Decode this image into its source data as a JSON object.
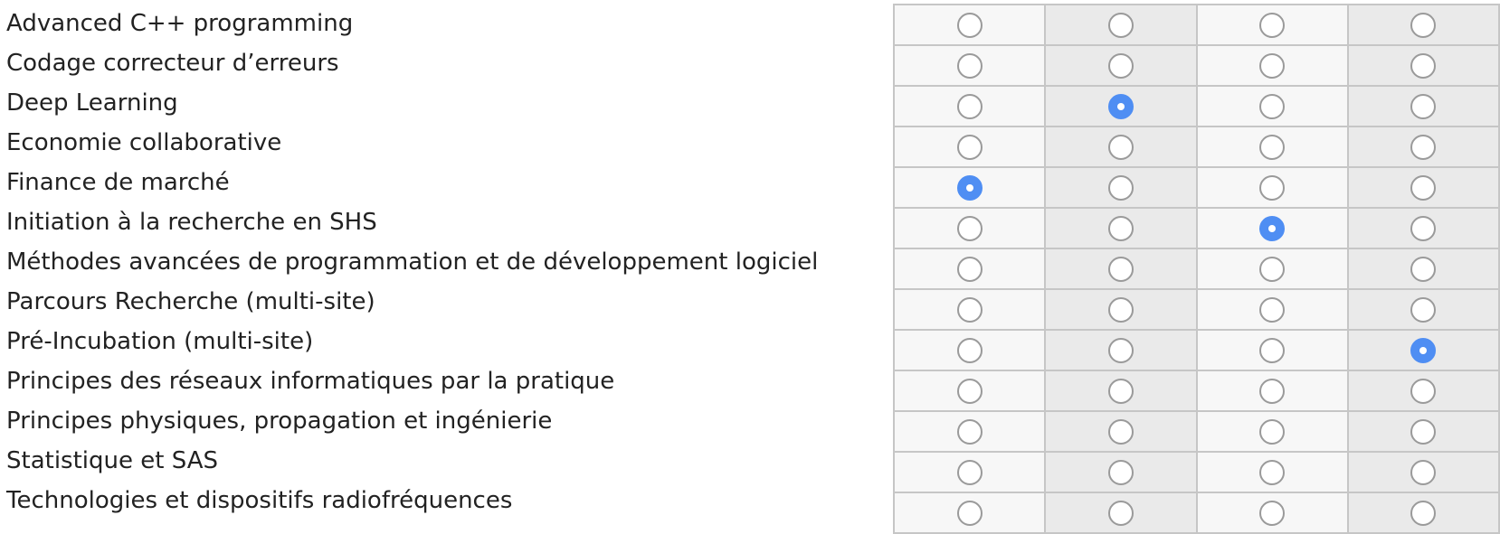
{
  "rows": [
    {
      "label": "Advanced C++ programming",
      "selected": null
    },
    {
      "label": "Codage correcteur d’erreurs",
      "selected": null
    },
    {
      "label": "Deep Learning",
      "selected": 1
    },
    {
      "label": "Economie collaborative",
      "selected": null
    },
    {
      "label": "Finance de marché",
      "selected": 0
    },
    {
      "label": "Initiation à la recherche en SHS",
      "selected": 2
    },
    {
      "label": "Méthodes avancées de programmation et de développement logiciel",
      "selected": null
    },
    {
      "label": "Parcours Recherche (multi-site)",
      "selected": null
    },
    {
      "label": "Pré-Incubation (multi-site)",
      "selected": 3
    },
    {
      "label": "Principes des réseaux informatiques par la pratique",
      "selected": null
    },
    {
      "label": "Principes physiques, propagation et ingénierie",
      "selected": null
    },
    {
      "label": "Statistique et SAS",
      "selected": null
    },
    {
      "label": "Technologies et dispositifs radiofréquences",
      "selected": null
    }
  ],
  "columns": 4,
  "colors": {
    "selected": "#4f8ef3",
    "cell_light": "#f7f7f7",
    "cell_dark": "#eaeaea",
    "grid_border": "#c6c6c6"
  }
}
